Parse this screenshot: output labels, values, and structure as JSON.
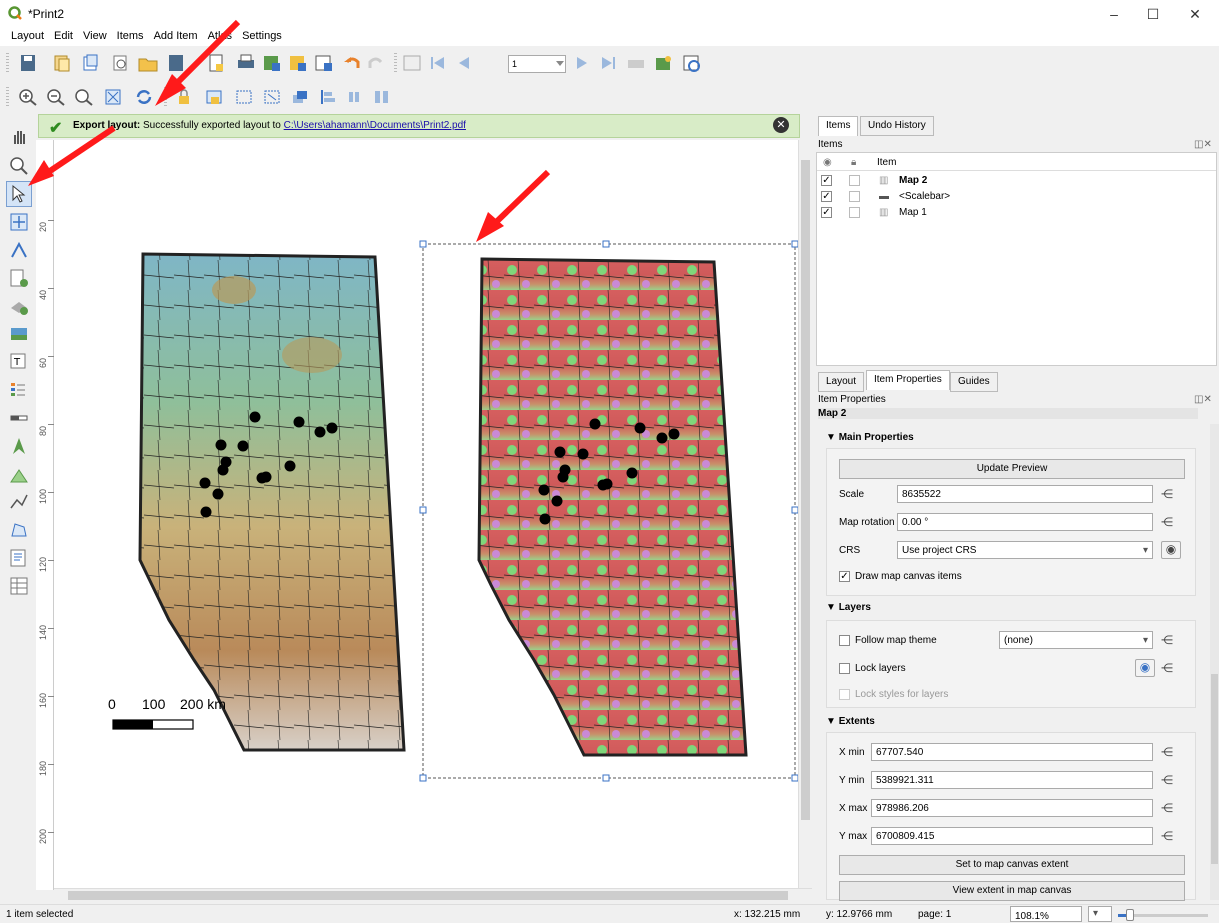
{
  "window": {
    "title": "*Print2",
    "min": "–",
    "max": "☐",
    "close": "✕"
  },
  "menu": [
    "Layout",
    "Edit",
    "View",
    "Items",
    "Add Item",
    "Atlas",
    "Settings"
  ],
  "toolbar": {
    "page_value": "1"
  },
  "message": {
    "title": "Export layout:",
    "text": "Successfully exported layout to",
    "path": "C:\\Users\\ahamann\\Documents\\Print2.pdf"
  },
  "ruler_ticks": [
    "20",
    "40",
    "60",
    "80",
    "100",
    "120",
    "140",
    "160",
    "180",
    "200"
  ],
  "canvas": {
    "scalebar_labels": [
      "0",
      "100",
      "200 km"
    ]
  },
  "items_panel": {
    "tabs": [
      "Items",
      "Undo History"
    ],
    "header": "Items",
    "col_item": "Item",
    "rows": [
      {
        "label": "Map 2",
        "bold": true,
        "icon": "map-icon"
      },
      {
        "label": "<Scalebar>",
        "bold": false,
        "icon": "scalebar-icon"
      },
      {
        "label": "Map 1",
        "bold": false,
        "icon": "map-icon"
      }
    ]
  },
  "props_panel": {
    "tabs": [
      "Layout",
      "Item Properties",
      "Guides"
    ],
    "header": "Item Properties",
    "item_name": "Map 2",
    "main": {
      "title": "Main Properties",
      "update_btn": "Update Preview",
      "scale_label": "Scale",
      "scale_value": "8635522",
      "rotation_label": "Map rotation",
      "rotation_value": "0.00 °",
      "crs_label": "CRS",
      "crs_value": "Use project CRS",
      "draw_items": "Draw map canvas items"
    },
    "layers": {
      "title": "Layers",
      "follow_theme": "Follow map theme",
      "theme_value": "(none)",
      "lock_layers": "Lock layers",
      "lock_styles": "Lock styles for layers"
    },
    "extents": {
      "title": "Extents",
      "xmin_label": "X min",
      "xmin": "67707.540",
      "ymin_label": "Y min",
      "ymin": "5389921.311",
      "xmax_label": "X max",
      "xmax": "978986.206",
      "ymax_label": "Y max",
      "ymax": "6700809.415",
      "set_btn": "Set to map canvas extent",
      "view_btn": "View extent in map canvas"
    }
  },
  "status": {
    "selection": "1 item selected",
    "x": "x: 132.215 mm",
    "y": "y: 12.9766 mm",
    "page": "page: 1",
    "zoom": "108.1%"
  },
  "colors": {
    "arrow": "#ff1a1a",
    "accent": "#7a9fd1"
  }
}
